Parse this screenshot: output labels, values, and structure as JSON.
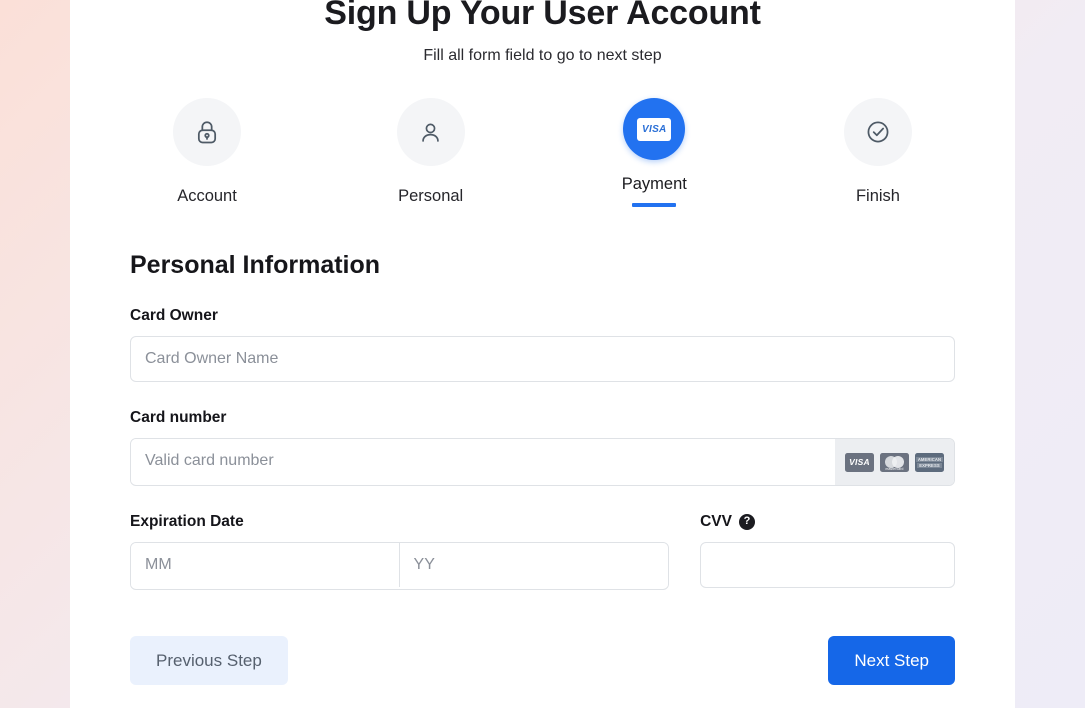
{
  "header": {
    "title": "Sign Up Your User Account",
    "subtitle": "Fill all form field to go to next step"
  },
  "stepper": {
    "steps": [
      {
        "label": "Account",
        "icon": "lock-icon",
        "state": "inactive"
      },
      {
        "label": "Personal",
        "icon": "user-icon",
        "state": "inactive"
      },
      {
        "label": "Payment",
        "icon": "visa-card-icon",
        "state": "active"
      },
      {
        "label": "Finish",
        "icon": "check-circle-icon",
        "state": "inactive"
      }
    ]
  },
  "form": {
    "section_title": "Personal Information",
    "card_owner": {
      "label": "Card Owner",
      "placeholder": "Card Owner Name",
      "value": ""
    },
    "card_number": {
      "label": "Card number",
      "placeholder": "Valid card number",
      "value": "",
      "brands": [
        "VISA",
        "Mastercard",
        "American Express"
      ]
    },
    "expiration": {
      "label": "Expiration Date",
      "month_placeholder": "MM",
      "month_value": "",
      "year_placeholder": "YY",
      "year_value": ""
    },
    "cvv": {
      "label": "CVV",
      "help_glyph": "?",
      "placeholder": "",
      "value": ""
    }
  },
  "actions": {
    "previous_label": "Previous Step",
    "next_label": "Next Step"
  },
  "colors": {
    "accent_blue": "#2272f0",
    "next_button": "#1567e8",
    "prev_button_bg": "#eaf1fd",
    "step_circle_bg": "#f4f5f7",
    "border": "#dfe2e6",
    "placeholder": "#8b9099"
  }
}
